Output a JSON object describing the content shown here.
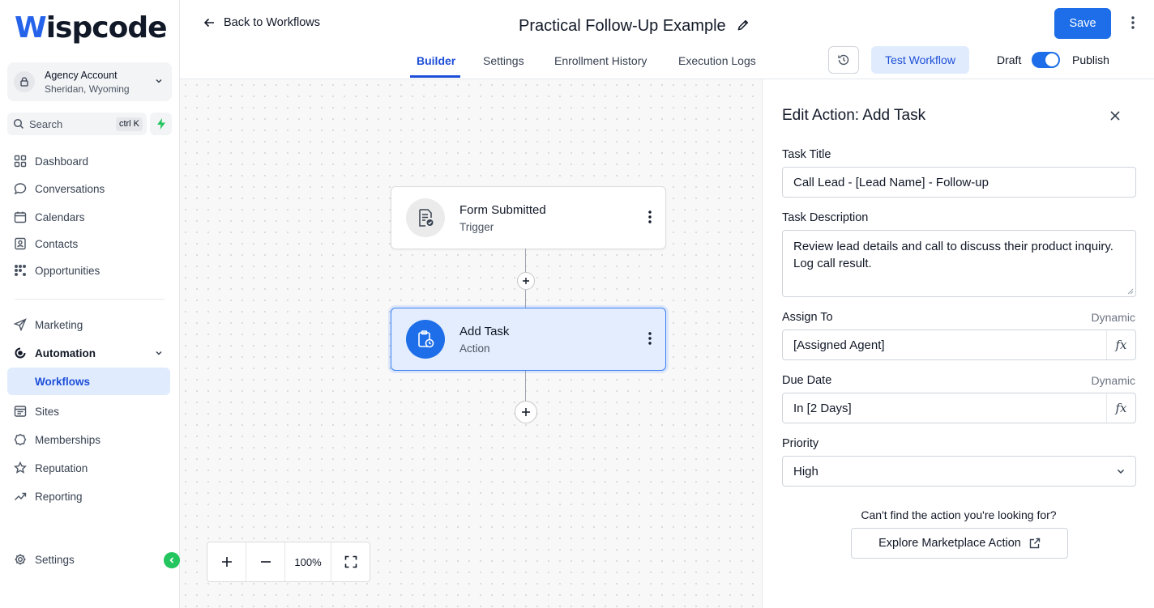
{
  "brand": {
    "logo_w": "W",
    "logo_rest": "ispcode",
    "accent": "#1d6ee8"
  },
  "account": {
    "name": "Agency Account",
    "location": "Sheridan, Wyoming"
  },
  "search": {
    "placeholder": "Search",
    "shortcut": "ctrl K"
  },
  "sidebar": {
    "items": [
      {
        "label": "Dashboard",
        "icon": "grid-icon"
      },
      {
        "label": "Conversations",
        "icon": "chat-icon"
      },
      {
        "label": "Calendars",
        "icon": "calendar-icon"
      },
      {
        "label": "Contacts",
        "icon": "contacts-icon"
      },
      {
        "label": "Opportunities",
        "icon": "opportunities-icon"
      },
      {
        "label": "Marketing",
        "icon": "send-icon"
      },
      {
        "label": "Automation",
        "icon": "automation-icon",
        "expanded": true
      },
      {
        "label": "Workflows",
        "active": true
      },
      {
        "label": "Sites",
        "icon": "sites-icon"
      },
      {
        "label": "Memberships",
        "icon": "badge-icon"
      },
      {
        "label": "Reputation",
        "icon": "star-icon"
      },
      {
        "label": "Reporting",
        "icon": "trend-icon"
      }
    ],
    "settings": "Settings"
  },
  "header": {
    "back": "Back to Workflows",
    "title": "Practical Follow-Up Example",
    "save": "Save",
    "tabs": [
      "Builder",
      "Settings",
      "Enrollment History",
      "Execution Logs"
    ],
    "active_tab": "Builder",
    "test_workflow": "Test Workflow",
    "draft": "Draft",
    "publish": "Publish",
    "published": true
  },
  "canvas": {
    "nodes": [
      {
        "title": "Form Submitted",
        "subtitle": "Trigger",
        "icon": "form-check-icon",
        "selected": false
      },
      {
        "title": "Add Task",
        "subtitle": "Action",
        "icon": "clipboard-clock-icon",
        "selected": true
      }
    ],
    "zoom": "100%"
  },
  "panel": {
    "title": "Edit Action: Add Task",
    "task_title_label": "Task Title",
    "task_title_value": "Call Lead - [Lead Name] - Follow-up",
    "task_desc_label": "Task Description",
    "task_desc_line1": "Review lead details and call to discuss their product inquiry.",
    "task_desc_line2": "Log call result.",
    "assign_label": "Assign To",
    "assign_dynamic": "Dynamic",
    "assign_value": "[Assigned Agent]",
    "due_label": "Due Date",
    "due_dynamic": "Dynamic",
    "due_value": "In [2 Days]",
    "priority_label": "Priority",
    "priority_value": "High",
    "fx_symbol": "fx",
    "cant_find": "Can't find the action you're looking for?",
    "explore": "Explore Marketplace Action"
  }
}
